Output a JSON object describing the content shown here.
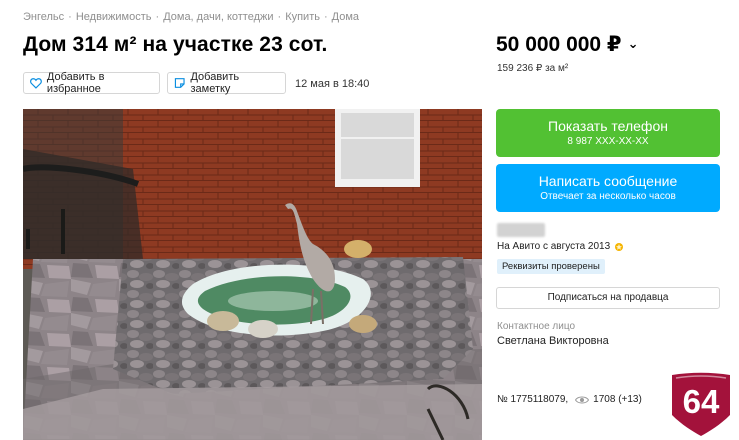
{
  "breadcrumbs": [
    "Энгельс",
    "Недвижимость",
    "Дома, дачи, коттеджи",
    "Купить",
    "Дома"
  ],
  "breadcrumb_separator": "·",
  "title": "Дом 314 м² на участке 23 сот.",
  "price": {
    "value": "50 000 000 ₽",
    "per_m2": "159 236 ₽ за м²"
  },
  "actions": {
    "favorite_label": "Добавить в избранное",
    "note_label": "Добавить заметку"
  },
  "published": "12 мая в 18:40",
  "phone_button": {
    "label": "Показать телефон",
    "number": "8 987 XXX-XX-XX",
    "color": "#52c133"
  },
  "message_button": {
    "label": "Написать сообщение",
    "sub": "Отвечает за несколько часов",
    "color": "#00aaff"
  },
  "seller": {
    "since": "На Авито с августа 2013",
    "verified": "Реквизиты проверены",
    "subscribe_label": "Подписаться на продавца",
    "contact_label": "Контактное лицо",
    "contact_name": "Светлана Викторовна"
  },
  "listing": {
    "number": "№ 1775118079,",
    "views": "1708 (+13)"
  },
  "watermark": {
    "text": "64",
    "color": "#a3123b"
  },
  "icons": [
    "heart-icon",
    "note-icon",
    "chevron-down-icon",
    "star-badge-icon",
    "eye-icon"
  ]
}
